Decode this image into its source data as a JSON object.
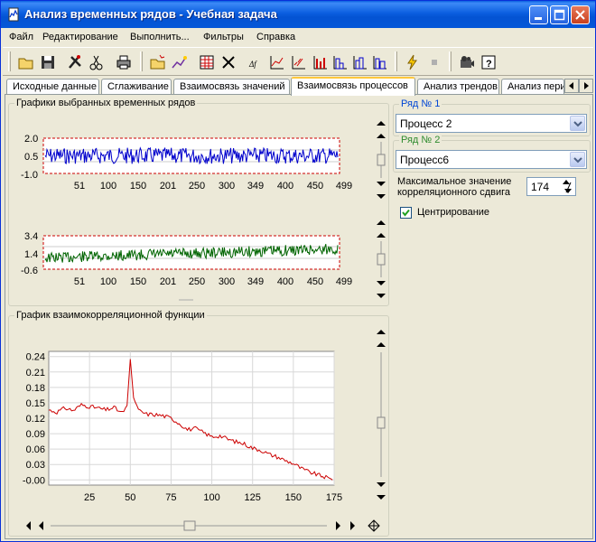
{
  "window": {
    "title": "Анализ временных рядов - Учебная задача"
  },
  "menu": [
    "Файл",
    "Редактирование",
    "Выполнить...",
    "Фильтры",
    "Справка"
  ],
  "tabs": [
    {
      "label": "Исходные данные"
    },
    {
      "label": "Сглаживание"
    },
    {
      "label": "Взаимосвязь значений"
    },
    {
      "label": "Взаимосвязь процессов"
    },
    {
      "label": "Анализ трендов"
    },
    {
      "label": "Анализ пери"
    }
  ],
  "active_tab": 3,
  "series_panel": {
    "title": "Графики выбранных временных рядов",
    "chart1": {
      "color": "#0000cc",
      "yticks": [
        "2.0",
        "0.5",
        "-1.0"
      ],
      "xticks": [
        "51",
        "100",
        "150",
        "201",
        "250",
        "300",
        "349",
        "400",
        "450",
        "499"
      ]
    },
    "chart2": {
      "color": "#006400",
      "yticks": [
        "3.4",
        "1.4",
        "-0.6"
      ],
      "xticks": [
        "51",
        "100",
        "150",
        "201",
        "250",
        "300",
        "349",
        "400",
        "450",
        "499"
      ]
    }
  },
  "ccf_panel": {
    "title": "График взаимокорреляционной функции"
  },
  "right_panel": {
    "series1_label": "Ряд  № 1",
    "series1_value": "Процесс 2",
    "series2_label": "Ряд  № 2",
    "series2_value": "Процесс6",
    "max_shift_label_1": "Максимальное значение",
    "max_shift_label_2": "корреляционного сдвига",
    "max_shift_value": "174",
    "centering_label": "Центрирование",
    "centering_checked": true
  },
  "chart_data": {
    "type": "line",
    "title": "График взаимокорреляционной функции",
    "xlabel": "",
    "ylabel": "",
    "xlim": [
      0,
      175
    ],
    "ylim": [
      -0.01,
      0.25
    ],
    "xticks": [
      "25",
      "50",
      "75",
      "100",
      "125",
      "150",
      "175"
    ],
    "yticks": [
      "0.24",
      "0.21",
      "0.18",
      "0.15",
      "0.12",
      "0.09",
      "0.06",
      "0.03",
      "-0.00"
    ],
    "grid": true,
    "color": "#cc0000",
    "series": [
      {
        "x": [
          0,
          5,
          10,
          15,
          20,
          25,
          30,
          35,
          40,
          45,
          48,
          50,
          52,
          55,
          60,
          65,
          70,
          75,
          80,
          85,
          90,
          95,
          100,
          105,
          110,
          115,
          120,
          125,
          130,
          135,
          140,
          145,
          150,
          155,
          160,
          165,
          170,
          174
        ],
        "values": [
          0.136,
          0.132,
          0.14,
          0.135,
          0.146,
          0.143,
          0.14,
          0.136,
          0.141,
          0.13,
          0.145,
          0.235,
          0.16,
          0.135,
          0.128,
          0.127,
          0.125,
          0.12,
          0.11,
          0.098,
          0.1,
          0.092,
          0.084,
          0.086,
          0.079,
          0.074,
          0.07,
          0.062,
          0.058,
          0.05,
          0.045,
          0.038,
          0.032,
          0.022,
          0.015,
          0.01,
          0.005,
          0.0
        ]
      }
    ]
  }
}
